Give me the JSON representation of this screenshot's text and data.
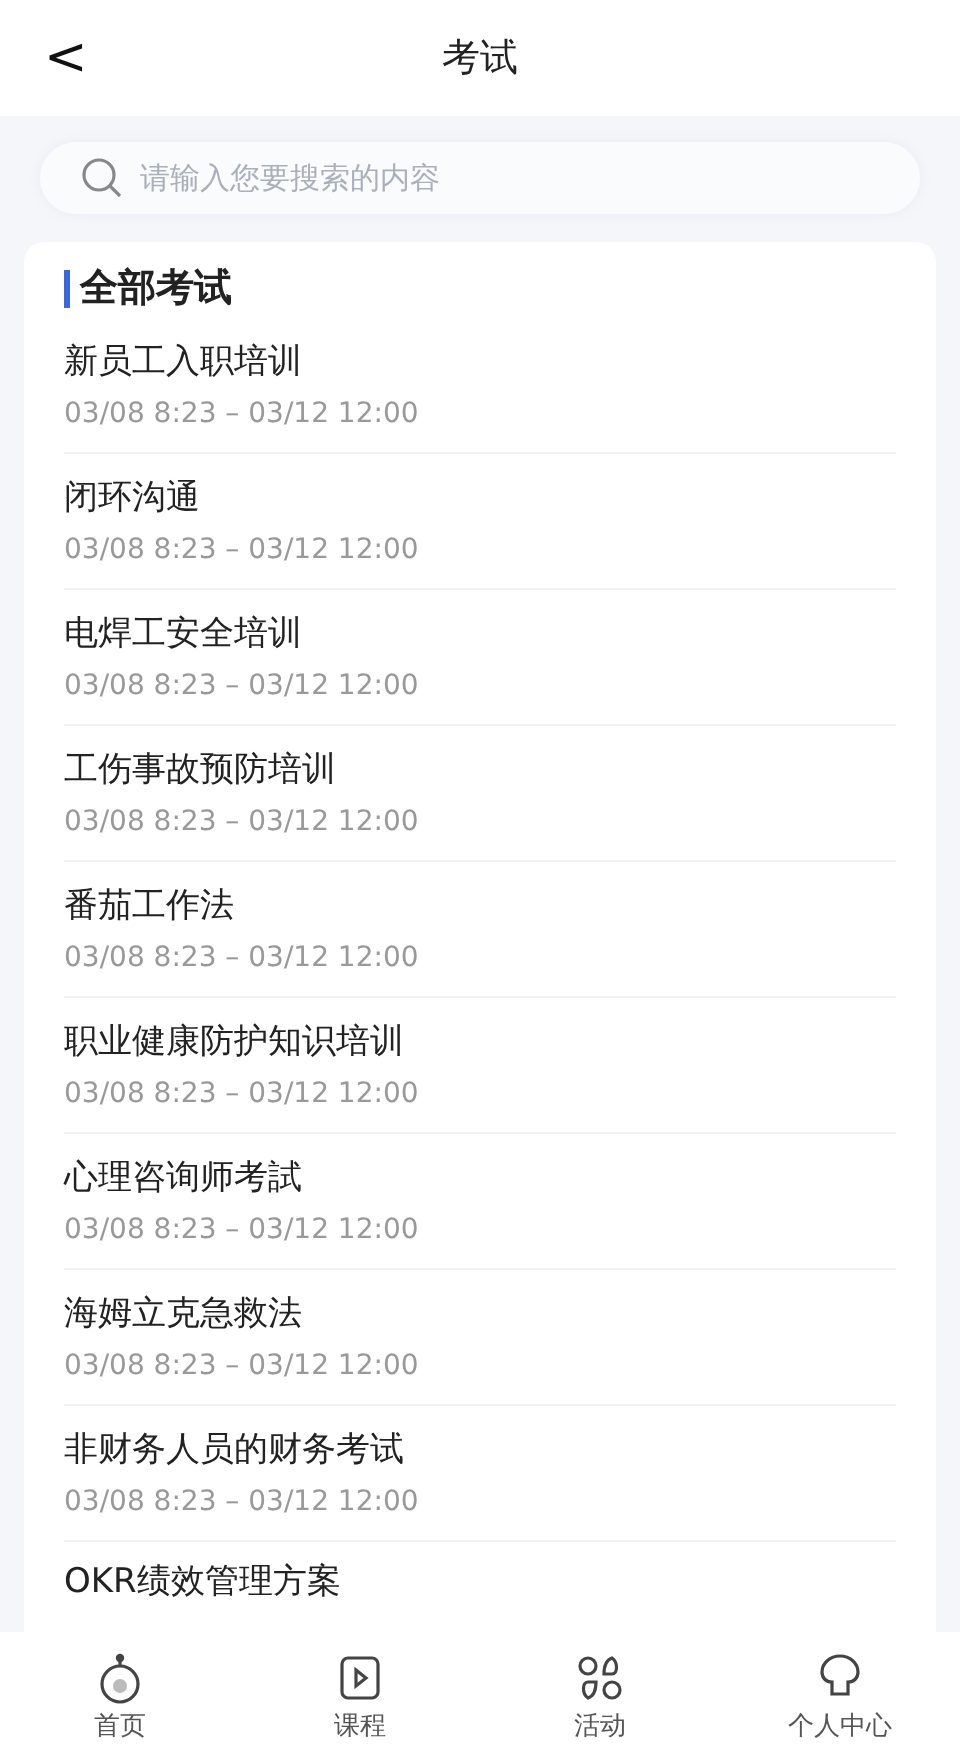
{
  "header": {
    "back_icon": "<",
    "title": "考试"
  },
  "search": {
    "placeholder": "请输入您要搜索的内容"
  },
  "section": {
    "title": "全部考试"
  },
  "exams": [
    {
      "title": "新员工入职培训",
      "time": "03/08 8:23 – 03/12 12:00"
    },
    {
      "title": "闭环沟通",
      "time": "03/08 8:23 – 03/12 12:00"
    },
    {
      "title": "电焊工安全培训",
      "time": "03/08 8:23 – 03/12 12:00"
    },
    {
      "title": "工伤事故预防培训",
      "time": "03/08 8:23 – 03/12 12:00"
    },
    {
      "title": "番茄工作法",
      "time": "03/08 8:23 – 03/12 12:00"
    },
    {
      "title": "职业健康防护知识培训",
      "time": "03/08 8:23 – 03/12 12:00"
    },
    {
      "title": "心理咨询师考試",
      "time": "03/08 8:23 – 03/12 12:00"
    },
    {
      "title": "海姆立克急救法",
      "time": "03/08 8:23 – 03/12 12:00"
    },
    {
      "title": "非财务人员的财务考试",
      "time": "03/08 8:23 – 03/12 12:00"
    },
    {
      "title": "OKR绩效管理方案"
    }
  ],
  "tab_bar": [
    {
      "kind": "home",
      "label": "首页"
    },
    {
      "kind": "course",
      "label": "课程"
    },
    {
      "kind": "activity",
      "label": "活动"
    },
    {
      "kind": "profile",
      "label": "个人中心"
    }
  ]
}
